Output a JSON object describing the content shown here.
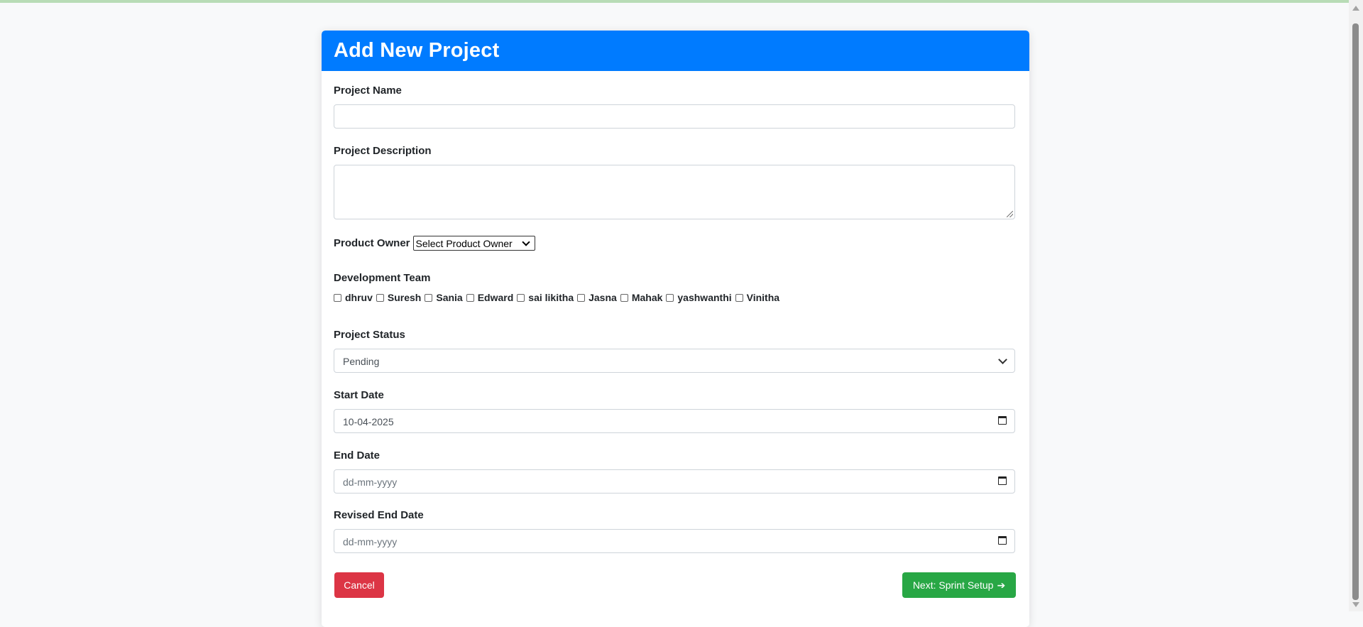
{
  "form": {
    "title": "Add New Project",
    "project_name": {
      "label": "Project Name",
      "value": ""
    },
    "project_description": {
      "label": "Project Description",
      "value": ""
    },
    "product_owner": {
      "label": "Product Owner",
      "selected": "Select Product Owner"
    },
    "development_team": {
      "label": "Development Team",
      "members": [
        "dhruv",
        "Suresh",
        "Sania",
        "Edward",
        "sai likitha",
        "Jasna",
        "Mahak",
        "yashwanthi",
        "Vinitha"
      ]
    },
    "project_status": {
      "label": "Project Status",
      "selected": "Pending"
    },
    "start_date": {
      "label": "Start Date",
      "value": "10-04-2025"
    },
    "end_date": {
      "label": "End Date",
      "placeholder": "dd-mm-yyyy"
    },
    "revised_end_date": {
      "label": "Revised End Date",
      "placeholder": "dd-mm-yyyy"
    },
    "cancel_label": "Cancel",
    "next_label": "Next: Sprint Setup",
    "next_arrow": "➔"
  },
  "colors": {
    "header": "#007bff",
    "cancel": "#dc3545",
    "next": "#28a745",
    "background": "#f8f9fa"
  },
  "icons": [
    "calendar-icon",
    "chevron-down-icon",
    "arrow-right-icon",
    "resize-grip-icon"
  ]
}
